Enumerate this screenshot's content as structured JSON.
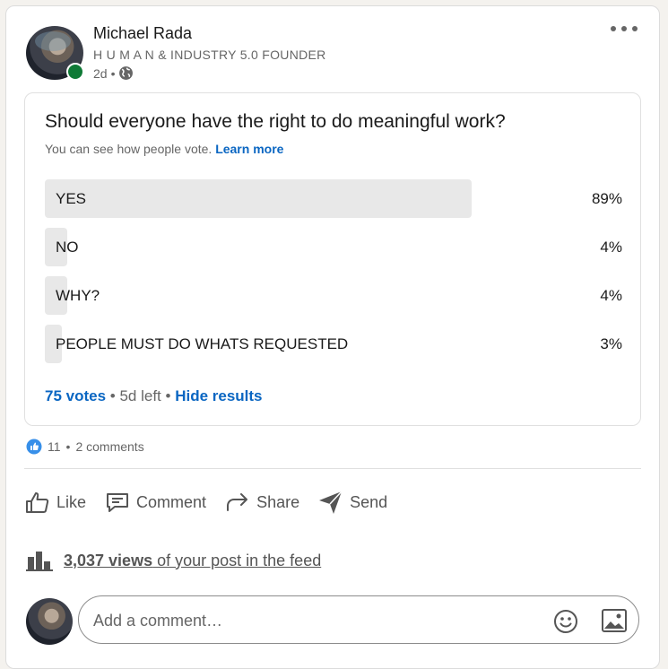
{
  "post": {
    "author_name": "Michael Rada",
    "author_headline": "H U M A N & INDUSTRY 5.0 FOUNDER",
    "time_ago": "2d",
    "separator": "•",
    "visibility_icon": "globe-icon",
    "more_icon": "more-horizontal-icon"
  },
  "poll": {
    "question": "Should everyone have the right to do meaningful work?",
    "subtext": "You can see how people vote.",
    "learn_more": "Learn more",
    "options": [
      {
        "label": "YES",
        "percent_text": "89%",
        "percent": 89
      },
      {
        "label": "NO",
        "percent_text": "4%",
        "percent": 4
      },
      {
        "label": "WHY?",
        "percent_text": "4%",
        "percent": 4
      },
      {
        "label": "PEOPLE MUST DO WHATS REQUESTED",
        "percent_text": "3%",
        "percent": 3
      }
    ],
    "votes": "75 votes",
    "time_left": "5d left",
    "hide_results": "Hide results",
    "dot": "•"
  },
  "social": {
    "reactions": "11",
    "dot": "•",
    "comments": "2 comments"
  },
  "actions": {
    "like": "Like",
    "comment": "Comment",
    "share": "Share",
    "send": "Send"
  },
  "views": {
    "count": "3,037 views",
    "suffix": " of your post in the feed"
  },
  "comment_box": {
    "placeholder": "Add a comment…"
  },
  "colors": {
    "accent": "#0a66c2",
    "online": "#0f7a36",
    "bar": "#e8e8e8"
  }
}
